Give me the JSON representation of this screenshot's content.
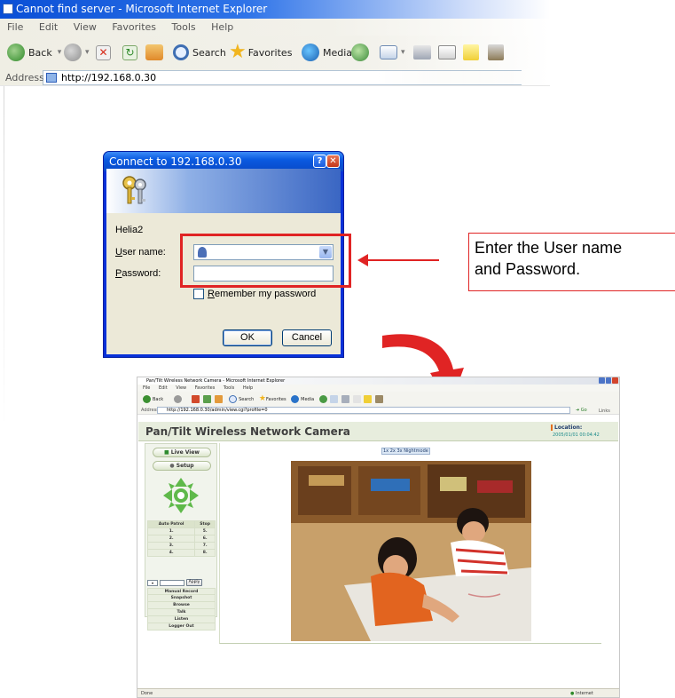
{
  "ie": {
    "title": "Cannot find server - Microsoft Internet Explorer",
    "menu": [
      "File",
      "Edit",
      "View",
      "Favorites",
      "Tools",
      "Help"
    ],
    "toolbar": {
      "back": "Back",
      "search": "Search",
      "favorites": "Favorites",
      "media": "Media"
    },
    "address_label": "Address",
    "address_value": "http://192.168.0.30"
  },
  "dialog": {
    "title": "Connect to 192.168.0.30",
    "site": "Helia2",
    "user_label_u": "U",
    "user_label_rest": "ser name:",
    "password_label_u": "P",
    "password_label_rest": "assword:",
    "remember_u": "R",
    "remember_rest": "emember my password",
    "ok": "OK",
    "cancel": "Cancel"
  },
  "callout": {
    "line1": "Enter the User name",
    "line2": "and Password."
  },
  "camera_browser": {
    "title": "Pan/Tilt Wireless Network Camera - Microsoft Internet Explorer",
    "menu": [
      "File",
      "Edit",
      "View",
      "Favorites",
      "Tools",
      "Help"
    ],
    "toolbar": {
      "back": "Back",
      "search": "Search",
      "favorites": "Favorites",
      "media": "Media"
    },
    "address_label": "Address",
    "address_value": "http://192.168.0.30/admin/view.cgi?profile=0",
    "go": "Go",
    "links": "Links",
    "heading": "Pan/Tilt Wireless Network Camera",
    "location_label": "Location:",
    "location_time": "2005/01/01 00:04:42",
    "live_view": "Live View",
    "setup": "Setup",
    "patrol_header": [
      "Auto Patrol",
      "Stop"
    ],
    "patrol_rows": [
      [
        "1.",
        "5."
      ],
      [
        "2.",
        "6."
      ],
      [
        "3.",
        "7."
      ],
      [
        "4.",
        "8."
      ]
    ],
    "apply": "Apply",
    "menu_items": [
      "Manual Record",
      "Snapshot",
      "Browse",
      "Talk",
      "Listen",
      "Logger Out"
    ],
    "resolution": [
      "1x",
      "2x",
      "3x",
      "Nightmode"
    ],
    "status_left": "Done",
    "status_zone": "Internet"
  }
}
